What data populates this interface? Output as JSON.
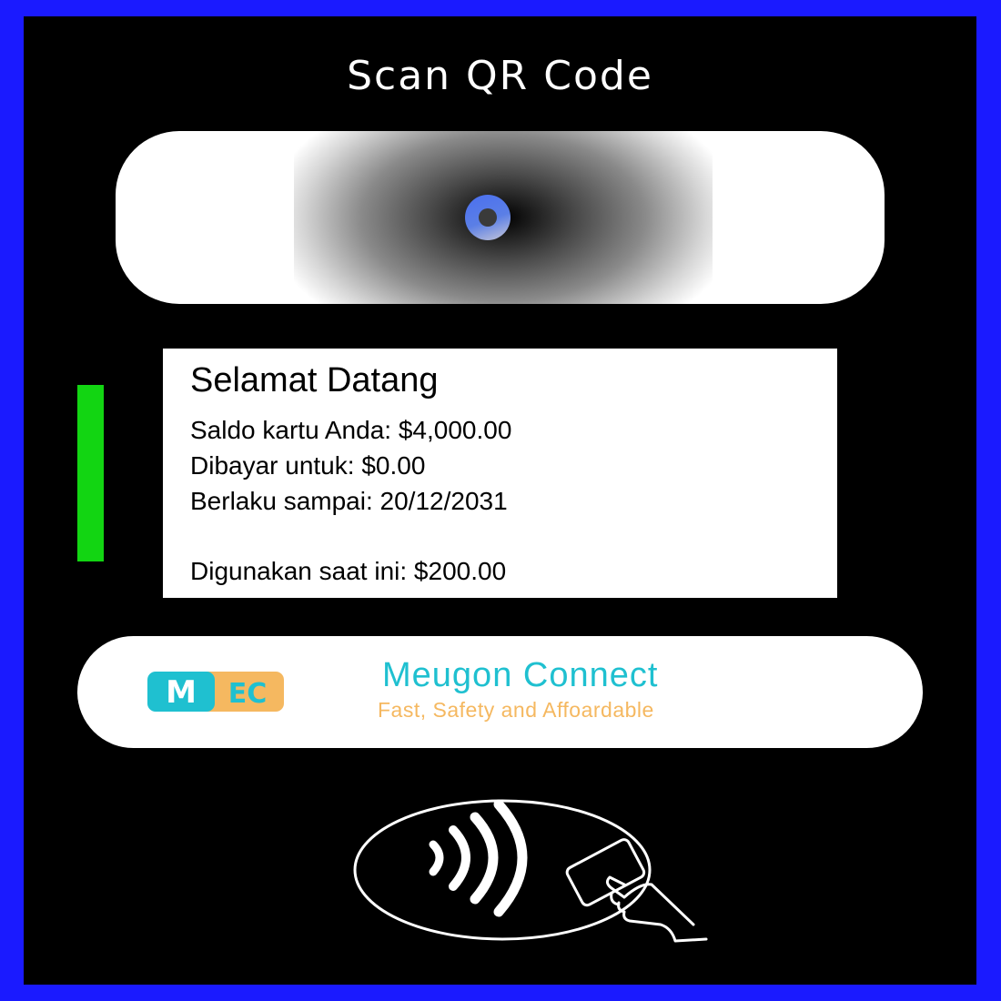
{
  "screen": {
    "title": "Scan QR Code"
  },
  "scanner": {
    "state_icon": "qr-scanner-lens-icon"
  },
  "status_indicator": {
    "color": "#12d512"
  },
  "card_info": {
    "heading": "Selamat Datang",
    "balance": "Saldo kartu Anda: $4,000.00",
    "paid_for": "Dibayar untuk: $0.00",
    "valid_until": "Berlaku sampai: 20/12/2031",
    "in_use": "Digunakan saat ini: $200.00"
  },
  "brand": {
    "logo_text_m": "M",
    "logo_text_ec": "EC",
    "name": "Meugon Connect",
    "tagline": "Fast, Safety and Affoardable",
    "name_color": "#1fc0d0",
    "tagline_color": "#f5b860"
  },
  "nfc": {
    "icon": "contactless-payment-icon"
  },
  "colors": {
    "border": "#1a1aff",
    "background": "#000000",
    "panel": "#ffffff"
  }
}
